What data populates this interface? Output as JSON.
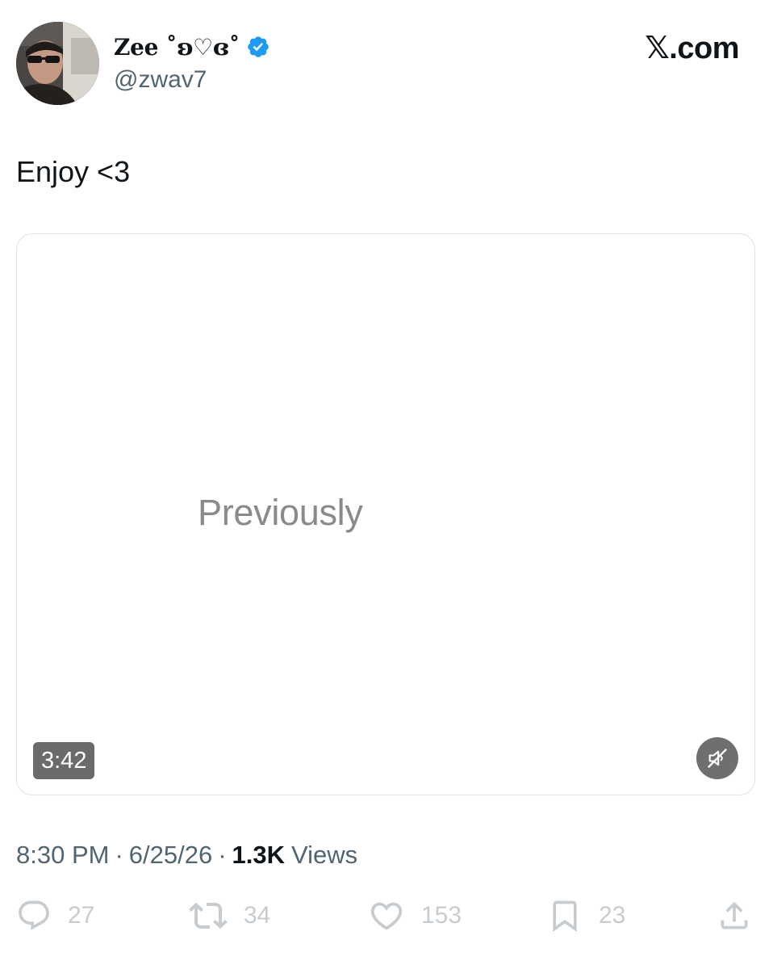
{
  "author": {
    "display_name": "Zee ˚ʚ♡ɞ˚",
    "handle": "@zwav7",
    "verified": true,
    "verified_color": "#1d9bf0"
  },
  "brand": "𝕏.com",
  "tweet": {
    "text": "Enjoy <3"
  },
  "media": {
    "type": "video",
    "caption": "Previously",
    "duration": "3:42",
    "muted": true
  },
  "meta": {
    "time": "8:30 PM",
    "separator": "·",
    "date": "6/25/26",
    "views_count": "1.3K",
    "views_label": "Views"
  },
  "actions": {
    "replies": "27",
    "reposts": "34",
    "likes": "153",
    "bookmarks": "23"
  },
  "icons": {
    "reply": "reply-bubble-icon",
    "repost": "repost-arrows-icon",
    "like": "heart-icon",
    "bookmark": "bookmark-icon",
    "share": "share-upload-icon",
    "mute": "speaker-muted-icon",
    "verified": "verified-badge-icon"
  },
  "colors": {
    "text_primary": "#0f1419",
    "text_secondary": "#536471",
    "action_gray": "#c7ccd1"
  }
}
